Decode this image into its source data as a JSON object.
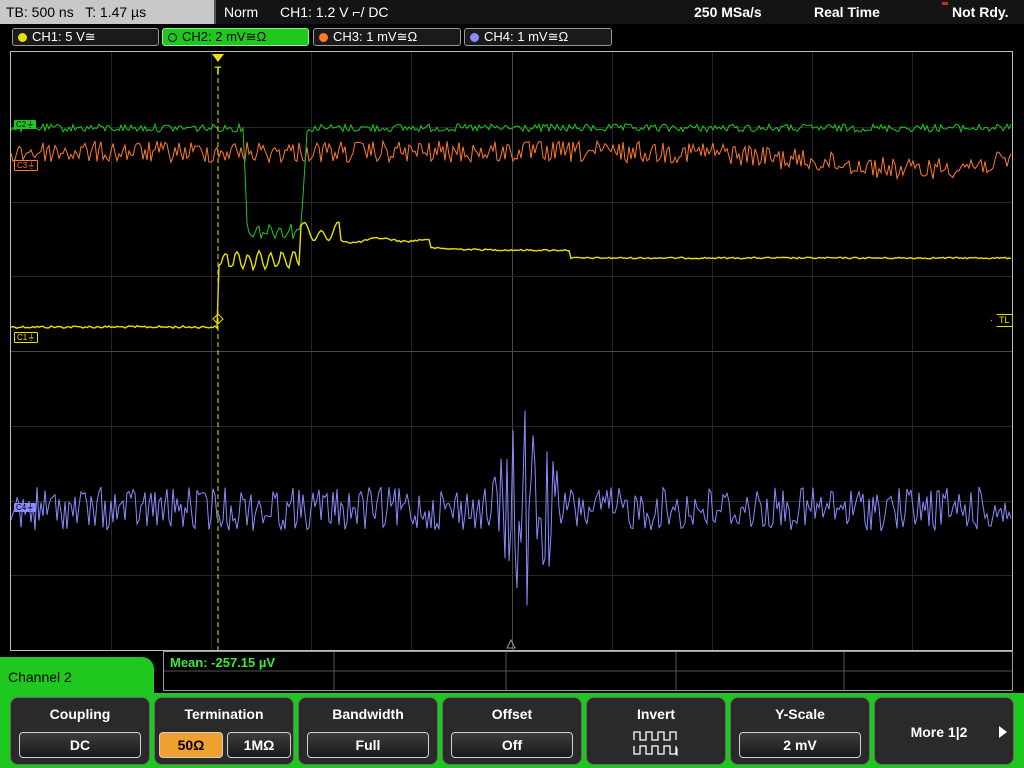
{
  "status": {
    "tb": "TB: 500 ns   T: 1.47 µs",
    "mode": "Norm",
    "trigger": "CH1: 1.2 V ⌐/ DC",
    "sample_rate": "250 MSa/s",
    "acq": "Real Time",
    "state": "Not Rdy."
  },
  "channels": [
    {
      "label": "CH1: 5 V≅",
      "color": "#e8e000"
    },
    {
      "label": "CH2: 2 mV≅Ω",
      "color": "#1ec81e"
    },
    {
      "label": "CH3: 1 mV≅Ω",
      "color": "#ff7a2a"
    },
    {
      "label": "CH4: 1 mV≅Ω",
      "color": "#8a8aff"
    }
  ],
  "markers": {
    "c1": "C1⏚",
    "c2": "C2⏚",
    "c3": "C3⏚",
    "c4": "C4⏚",
    "tl": "TL",
    "trigger_pos": "T"
  },
  "measurement": {
    "mean": "Mean: -257.15 µV"
  },
  "menu": {
    "title": "Channel 2",
    "coupling": {
      "title": "Coupling",
      "value": "DC"
    },
    "termination": {
      "title": "Termination",
      "selected": "50Ω",
      "other": "1MΩ"
    },
    "bandwidth": {
      "title": "Bandwidth",
      "value": "Full"
    },
    "offset": {
      "title": "Offset",
      "value": "Off"
    },
    "invert": {
      "title": "Invert",
      "icon": "invert-waveform-icon"
    },
    "yscale": {
      "title": "Y-Scale",
      "value": "2 mV"
    },
    "more": {
      "label": "More 1|2",
      "icon": "chevron-right-icon"
    }
  }
}
